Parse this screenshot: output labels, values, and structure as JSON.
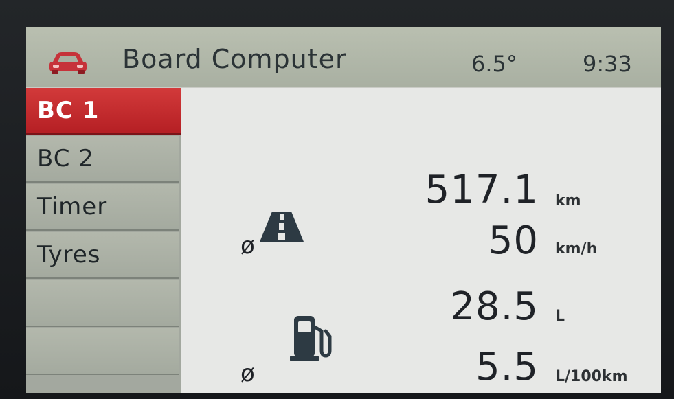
{
  "header": {
    "title": "Board Computer",
    "temperature": "6.5°",
    "time": "9:33",
    "icon": "car-icon"
  },
  "tabs": [
    {
      "label": "BC 1",
      "active": true
    },
    {
      "label": "BC 2",
      "active": false
    },
    {
      "label": "Timer",
      "active": false
    },
    {
      "label": "Tyres",
      "active": false
    },
    {
      "label": "",
      "active": false
    },
    {
      "label": "",
      "active": false
    }
  ],
  "trip": {
    "icon": "road-icon",
    "distance_value": "517.1",
    "distance_unit": "km",
    "avg_symbol": "ø",
    "avg_speed_value": "50",
    "avg_speed_unit": "km/h"
  },
  "fuel": {
    "icon": "fuel-pump-icon",
    "used_value": "28.5",
    "used_unit": "L",
    "avg_symbol": "ø",
    "avg_consumption_value": "5.5",
    "avg_consumption_unit": "L/100km"
  },
  "colors": {
    "accent": "#c62a2e",
    "header_bg": "#b1b8a9",
    "content_bg": "#e7e8e6",
    "text": "#1f2227"
  }
}
